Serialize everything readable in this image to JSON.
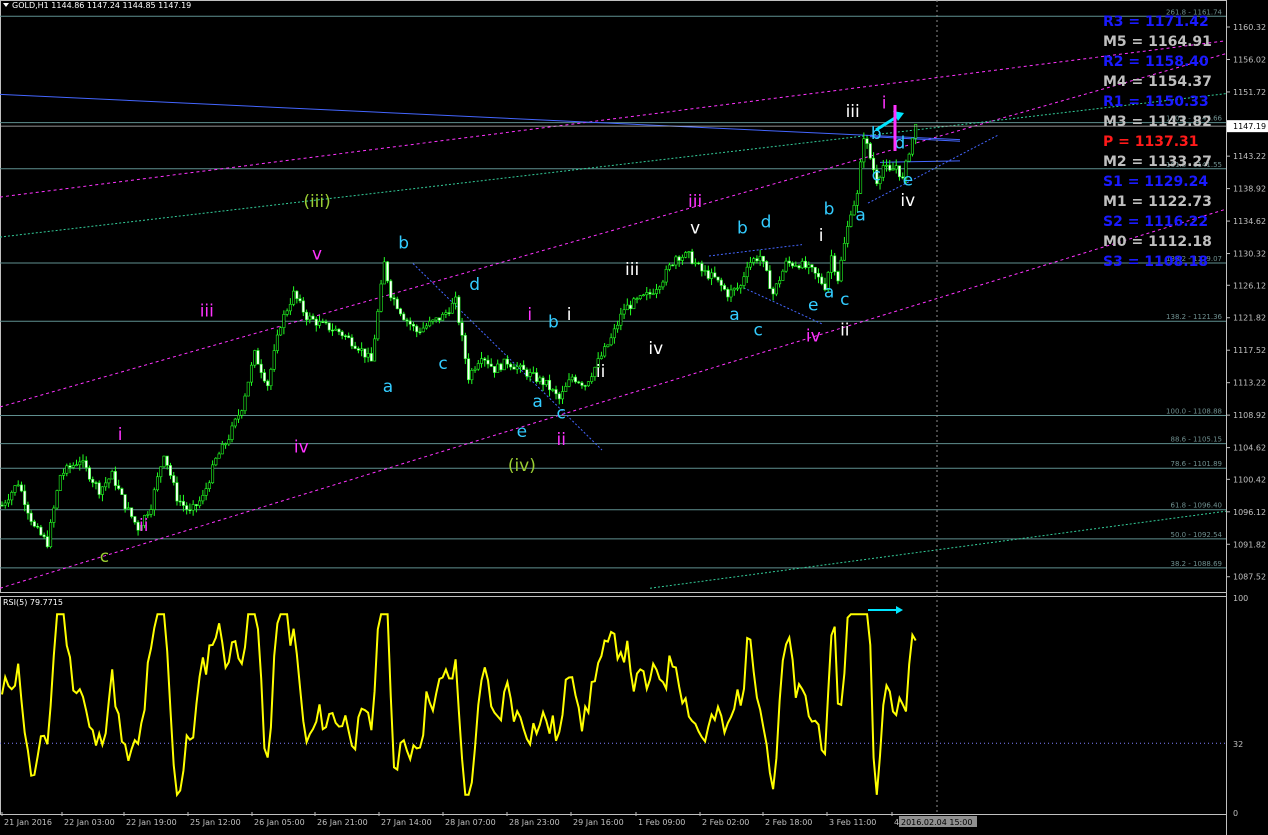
{
  "header": {
    "symbol": "GOLD,H1",
    "ohlc": "1144.86 1147.24 1144.85 1147.19"
  },
  "rsi_header": "RSI(5) 79.7715",
  "chart_data": [
    {
      "type": "candlestick",
      "title": "GOLD,H1",
      "ylim": [
        1085.5,
        1163.5
      ],
      "y_ticks": [
        "1160.32",
        "1156.02",
        "1151.72",
        "1147.42",
        "1143.22",
        "1138.92",
        "1134.62",
        "1130.32",
        "1126.12",
        "1121.82",
        "1117.52",
        "1113.22",
        "1108.92",
        "1104.62",
        "1100.42",
        "1096.12",
        "1091.82",
        "1087.52"
      ],
      "current_price": "1147.19",
      "x_labels": [
        "21 Jan 2016",
        "22 Jan 03:00",
        "22 Jan 19:00",
        "25 Jan 12:00",
        "26 Jan 05:00",
        "26 Jan 21:00",
        "27 Jan 14:00",
        "28 Jan 07:00",
        "28 Jan 23:00",
        "29 Jan 16:00",
        "1 Feb 09:00",
        "2 Feb 02:00",
        "2 Feb 18:00",
        "3 Feb 11:00",
        "4",
        "2016.02.04 15:00"
      ],
      "close_path": [
        [
          0,
          1097
        ],
        [
          5,
          1100
        ],
        [
          10,
          1094
        ],
        [
          14,
          1092
        ],
        [
          18,
          1101
        ],
        [
          24,
          1103
        ],
        [
          30,
          1099
        ],
        [
          34,
          1101
        ],
        [
          38,
          1097
        ],
        [
          42,
          1094
        ],
        [
          46,
          1097
        ],
        [
          50,
          1104
        ],
        [
          54,
          1098
        ],
        [
          58,
          1096
        ],
        [
          62,
          1098
        ],
        [
          66,
          1103
        ],
        [
          70,
          1106
        ],
        [
          74,
          1110
        ],
        [
          78,
          1117
        ],
        [
          82,
          1113
        ],
        [
          86,
          1121
        ],
        [
          90,
          1125
        ],
        [
          94,
          1122
        ],
        [
          98,
          1121
        ],
        [
          104,
          1120
        ],
        [
          110,
          1118
        ],
        [
          114,
          1116
        ],
        [
          118,
          1129
        ],
        [
          120,
          1125
        ],
        [
          124,
          1122
        ],
        [
          128,
          1120
        ],
        [
          132,
          1121
        ],
        [
          136,
          1122
        ],
        [
          140,
          1124
        ],
        [
          144,
          1114
        ],
        [
          148,
          1117
        ],
        [
          152,
          1115
        ],
        [
          156,
          1116
        ],
        [
          160,
          1115
        ],
        [
          164,
          1114
        ],
        [
          168,
          1113
        ],
        [
          172,
          1111
        ],
        [
          176,
          1114
        ],
        [
          180,
          1113
        ],
        [
          184,
          1116
        ],
        [
          188,
          1119
        ],
        [
          192,
          1123
        ],
        [
          196,
          1124
        ],
        [
          200,
          1125
        ],
        [
          204,
          1127
        ],
        [
          208,
          1130
        ],
        [
          212,
          1130
        ],
        [
          216,
          1128
        ],
        [
          220,
          1127
        ],
        [
          224,
          1125
        ],
        [
          228,
          1126
        ],
        [
          230,
          1129
        ],
        [
          234,
          1130
        ],
        [
          238,
          1125
        ],
        [
          242,
          1129
        ],
        [
          246,
          1129
        ],
        [
          250,
          1128
        ],
        [
          254,
          1126
        ],
        [
          256,
          1130
        ],
        [
          258,
          1127
        ],
        [
          262,
          1136
        ],
        [
          264,
          1138
        ],
        [
          266,
          1146
        ],
        [
          268,
          1143
        ],
        [
          270,
          1140
        ],
        [
          272,
          1142
        ],
        [
          274,
          1141
        ],
        [
          276,
          1142
        ],
        [
          278,
          1140
        ],
        [
          280,
          1144
        ],
        [
          282,
          1147.19
        ]
      ],
      "pivot_levels": [
        {
          "name": "R3",
          "value": "1171.42",
          "color": "#1a1aff"
        },
        {
          "name": "M5",
          "value": "1164.91",
          "color": "#bfbfbf"
        },
        {
          "name": "R2",
          "value": "1158.40",
          "color": "#1a1aff"
        },
        {
          "name": "M4",
          "value": "1154.37",
          "color": "#bfbfbf"
        },
        {
          "name": "R1",
          "value": "1150.33",
          "color": "#1a1aff"
        },
        {
          "name": "M3",
          "value": "1143.82",
          "color": "#bfbfbf"
        },
        {
          "name": "P ",
          "value": "1137.31",
          "color": "#ff1a1a"
        },
        {
          "name": "M2",
          "value": "1133.27",
          "color": "#bfbfbf"
        },
        {
          "name": "S1",
          "value": "1129.24",
          "color": "#1a1aff"
        },
        {
          "name": "M1",
          "value": "1122.73",
          "color": "#bfbfbf"
        },
        {
          "name": "S2",
          "value": "1116.22",
          "color": "#1a1aff"
        },
        {
          "name": "M0",
          "value": "1112.18",
          "color": "#bfbfbf"
        },
        {
          "name": "S3",
          "value": "1108.18",
          "color": "#1a1aff"
        }
      ],
      "fib_levels": [
        {
          "label": "261.8 - 1161.74",
          "value": 1161.74
        },
        {
          "label": "100.0 - 1147.66",
          "value": 1147.66
        },
        {
          "label": "161.8 - 1141.55",
          "value": 1141.55
        },
        {
          "label": "138.2 - 1129.07",
          "value": 1129.07
        },
        {
          "label": "138.2 - 1121.36",
          "value": 1121.36
        },
        {
          "label": "100.0 - 1108.88",
          "value": 1108.88
        },
        {
          "label": "88.6 - 1105.15",
          "value": 1105.15
        },
        {
          "label": "78.6 - 1101.89",
          "value": 1101.89
        },
        {
          "label": "61.8 - 1096.40",
          "value": 1096.4
        },
        {
          "label": "50.0 - 1092.54",
          "value": 1092.54
        },
        {
          "label": "38.2 - 1088.69",
          "value": 1088.69
        }
      ],
      "wave_labels": [
        {
          "text": "c",
          "color": "#9acd32",
          "x": 13,
          "y": 1089.5
        },
        {
          "text": "i",
          "color": "#ff33ff",
          "x": 15,
          "y": 1105.6
        },
        {
          "text": "ii",
          "color": "#ff33ff",
          "x": 18,
          "y": 1093.6
        },
        {
          "text": "iv",
          "color": "#ff33ff",
          "x": 38,
          "y": 1104
        },
        {
          "text": "iii",
          "color": "#ff33ff",
          "x": 26,
          "y": 1122
        },
        {
          "text": "v",
          "color": "#ff33ff",
          "x": 40,
          "y": 1129.5
        },
        {
          "text": "(iii)",
          "color": "#9acd32",
          "x": 40,
          "y": 1136.5
        },
        {
          "text": "a",
          "color": "#33ccff",
          "x": 49,
          "y": 1112
        },
        {
          "text": "b",
          "color": "#33ccff",
          "x": 51,
          "y": 1131
        },
        {
          "text": "c",
          "color": "#33ccff",
          "x": 56,
          "y": 1115
        },
        {
          "text": "d",
          "color": "#33ccff",
          "x": 60,
          "y": 1125.5
        },
        {
          "text": "e",
          "color": "#33ccff",
          "x": 66,
          "y": 1106
        },
        {
          "text": "(iv)",
          "color": "#9acd32",
          "x": 66,
          "y": 1101.5
        },
        {
          "text": "ii",
          "color": "#ff33ff",
          "x": 71,
          "y": 1105
        },
        {
          "text": "i",
          "color": "#ff33ff",
          "x": 67,
          "y": 1121.5
        },
        {
          "text": "a",
          "color": "#33ccff",
          "x": 68,
          "y": 1110
        },
        {
          "text": "c",
          "color": "#33ccff",
          "x": 71,
          "y": 1108.5
        },
        {
          "text": "b",
          "color": "#33ccff",
          "x": 70,
          "y": 1120.5
        },
        {
          "text": "i",
          "color": "#ffffff",
          "x": 72,
          "y": 1121.5
        },
        {
          "text": "ii",
          "color": "#ffffff",
          "x": 76,
          "y": 1114
        },
        {
          "text": "iii",
          "color": "#ffffff",
          "x": 80,
          "y": 1127.5
        },
        {
          "text": "iv",
          "color": "#ffffff",
          "x": 83,
          "y": 1117
        },
        {
          "text": "iii",
          "color": "#ff33ff",
          "x": 88,
          "y": 1136.5
        },
        {
          "text": "v",
          "color": "#ffffff",
          "x": 88,
          "y": 1133
        },
        {
          "text": "a",
          "color": "#33ccff",
          "x": 93,
          "y": 1121.5
        },
        {
          "text": "b",
          "color": "#33ccff",
          "x": 94,
          "y": 1133
        },
        {
          "text": "c",
          "color": "#33ccff",
          "x": 96,
          "y": 1119.5
        },
        {
          "text": "d",
          "color": "#33ccff",
          "x": 97,
          "y": 1133.8
        },
        {
          "text": "e",
          "color": "#33ccff",
          "x": 103,
          "y": 1122.8
        },
        {
          "text": "iv",
          "color": "#ff33ff",
          "x": 103,
          "y": 1118.7
        },
        {
          "text": "i",
          "color": "#ffffff",
          "x": 104,
          "y": 1132
        },
        {
          "text": "a",
          "color": "#33ccff",
          "x": 105,
          "y": 1124.5
        },
        {
          "text": "c",
          "color": "#33ccff",
          "x": 107,
          "y": 1123.5
        },
        {
          "text": "ii",
          "color": "#ffffff",
          "x": 107,
          "y": 1119.5
        },
        {
          "text": "b",
          "color": "#33ccff",
          "x": 105,
          "y": 1135.5
        },
        {
          "text": "a",
          "color": "#33ccff",
          "x": 109,
          "y": 1134.7
        },
        {
          "text": "iii",
          "color": "#ffffff",
          "x": 108,
          "y": 1148.4
        },
        {
          "text": "b",
          "color": "#33ccff",
          "x": 111,
          "y": 1145.5
        },
        {
          "text": "c",
          "color": "#33ccff",
          "x": 111,
          "y": 1140
        },
        {
          "text": "d",
          "color": "#33ccff",
          "x": 114,
          "y": 1144.2
        },
        {
          "text": "e",
          "color": "#33ccff",
          "x": 115,
          "y": 1139.3
        },
        {
          "text": "iv",
          "color": "#ffffff",
          "x": 115,
          "y": 1136.6
        },
        {
          "text": "i",
          "color": "#ff33ff",
          "x": 112,
          "y": 1149.5
        }
      ]
    },
    {
      "type": "line",
      "title": "RSI(5) 79.7715",
      "ylim": [
        0,
        100
      ],
      "levels": [
        32
      ],
      "tick_labels": [
        "100",
        "32",
        "0"
      ],
      "current": 79.7715
    }
  ]
}
